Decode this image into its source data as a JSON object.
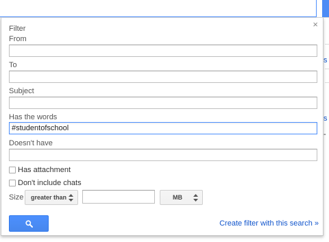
{
  "dialog": {
    "title": "Filter",
    "close_glyph": "×",
    "from_label": "From",
    "from_value": "",
    "to_label": "To",
    "to_value": "",
    "subject_label": "Subject",
    "subject_value": "",
    "has_words_label": "Has the words",
    "has_words_value": "#studentofschool",
    "doesnt_have_label": "Doesn't have",
    "doesnt_have_value": "",
    "has_attachment_label": "Has attachment",
    "has_attachment_checked": false,
    "dont_include_chats_label": "Don't include chats",
    "dont_include_chats_checked": false,
    "size_label": "Size",
    "size_comparator": "greater than",
    "size_value": "",
    "size_unit": "MB",
    "search_icon": "search-icon",
    "create_filter_link": "Create filter with this search »"
  },
  "background": {
    "fragment_1": "s",
    "fragment_2": "s",
    "fragment_3": "-",
    "link_color": "#1155cc",
    "accent_color": "#4d90fe"
  }
}
